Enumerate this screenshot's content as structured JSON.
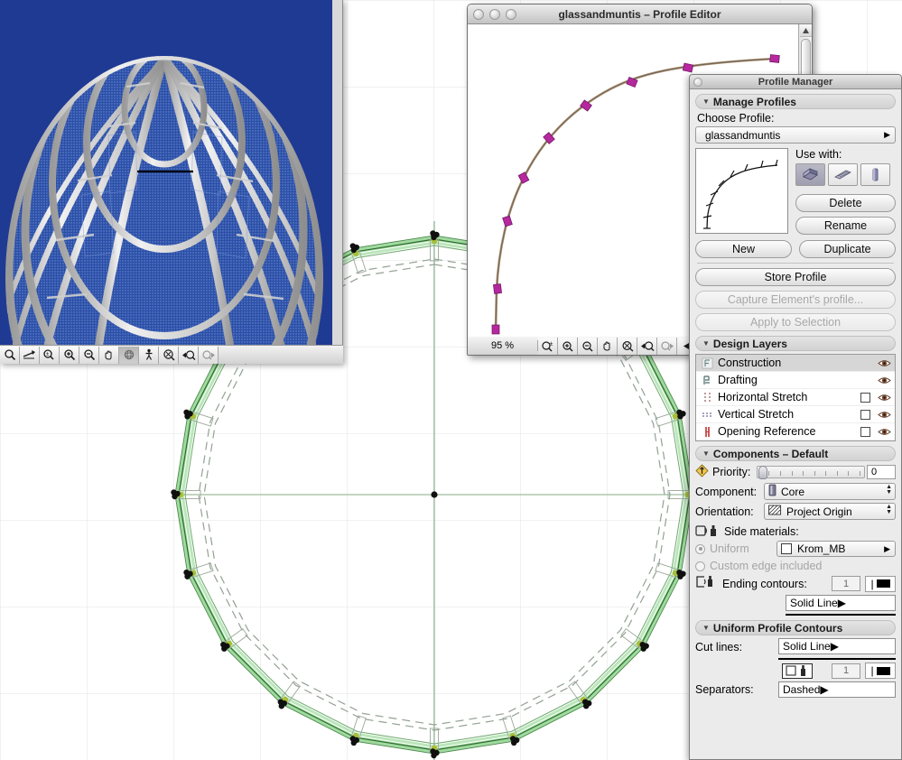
{
  "render_window": {
    "name": "3d-render-view",
    "background_color": "#1f3a93",
    "structure": "glass dome with muntins",
    "toolbar_icons": [
      "zoom-normal-icon",
      "flyover-icon",
      "zoom-percent-icon",
      "zoom-in-icon",
      "zoom-out-icon",
      "pan-hand-icon",
      "orbit-icon",
      "walkthrough-icon",
      "fit-to-window-icon",
      "previous-zoom-icon",
      "next-zoom-icon"
    ]
  },
  "profile_editor": {
    "title": "glassandmuntis – Profile Editor",
    "window_buttons": [
      "close",
      "minimize",
      "zoom"
    ],
    "zoom_value": "95 %",
    "toolbar_icons": [
      "zoom-percent-icon",
      "zoom-in-icon",
      "zoom-out-icon",
      "pan-hand-icon",
      "fit-to-window-icon",
      "previous-zoom-icon",
      "next-zoom-icon",
      "collapse-icon"
    ],
    "curve": {
      "stroke_color": "#a08a6e",
      "handle_color": "#b5289e",
      "handle_count": 9
    }
  },
  "profile_manager": {
    "title": "Profile Manager",
    "sections": {
      "manage_profiles": {
        "header": "Manage Profiles",
        "choose_profile_label": "Choose Profile:",
        "choose_profile_value": "glassandmuntis",
        "use_with_label": "Use with:",
        "use_with_icons": [
          "wall-icon",
          "beam-icon",
          "column-icon"
        ],
        "use_with_selected": 0,
        "buttons": {
          "delete": "Delete",
          "rename": "Rename",
          "new": "New",
          "duplicate": "Duplicate",
          "store_profile": "Store Profile",
          "capture_element": "Capture Element's profile...",
          "apply_to_selection": "Apply to Selection"
        },
        "disabled_buttons": [
          "Capture Element's profile...",
          "Apply to Selection"
        ]
      },
      "design_layers": {
        "header": "Design Layers",
        "layers": [
          {
            "name": "Construction",
            "icon": "construction-layer-icon",
            "has_checkbox": false,
            "checked": false,
            "visible": true,
            "selected": true
          },
          {
            "name": "Drafting",
            "icon": "drafting-layer-icon",
            "has_checkbox": false,
            "checked": false,
            "visible": true,
            "selected": false
          },
          {
            "name": "Horizontal Stretch",
            "icon": "horizontal-stretch-icon",
            "has_checkbox": true,
            "checked": false,
            "visible": true,
            "selected": false
          },
          {
            "name": "Vertical Stretch",
            "icon": "vertical-stretch-icon",
            "has_checkbox": true,
            "checked": false,
            "visible": true,
            "selected": false
          },
          {
            "name": "Opening Reference",
            "icon": "opening-reference-icon",
            "has_checkbox": true,
            "checked": false,
            "visible": true,
            "selected": false
          }
        ]
      },
      "components_default": {
        "header": "Components – Default",
        "priority_label": "Priority:",
        "priority_value": "0",
        "component_label": "Component:",
        "component_value": "Core",
        "orientation_label": "Orientation:",
        "orientation_value": "Project Origin",
        "side_materials_label": "Side materials:",
        "uniform_label": "Uniform",
        "uniform_material": "Krom_MB",
        "custom_edge_label": "Custom edge included",
        "ending_contours_label": "Ending contours:",
        "ending_contours_pen": "1",
        "ending_contours_line": "Solid Line"
      },
      "uniform_profile_contours": {
        "header": "Uniform Profile Contours",
        "cut_lines_label": "Cut lines:",
        "cut_lines_value": "Solid Line",
        "cut_lines_pen": "1",
        "separators_label": "Separators:",
        "separators_value": "Dashed"
      }
    }
  },
  "canvas": {
    "name": "floor-plan-canvas",
    "grid_color": "#e2e2e2",
    "axis_color": "#7ba77b",
    "polygon_fill": "#8fd08f",
    "polygon_stroke": "#3f7a3f",
    "node_color": "#111111",
    "dash_color": "#8a9a8a",
    "center_marker": true,
    "node_count": 20
  }
}
